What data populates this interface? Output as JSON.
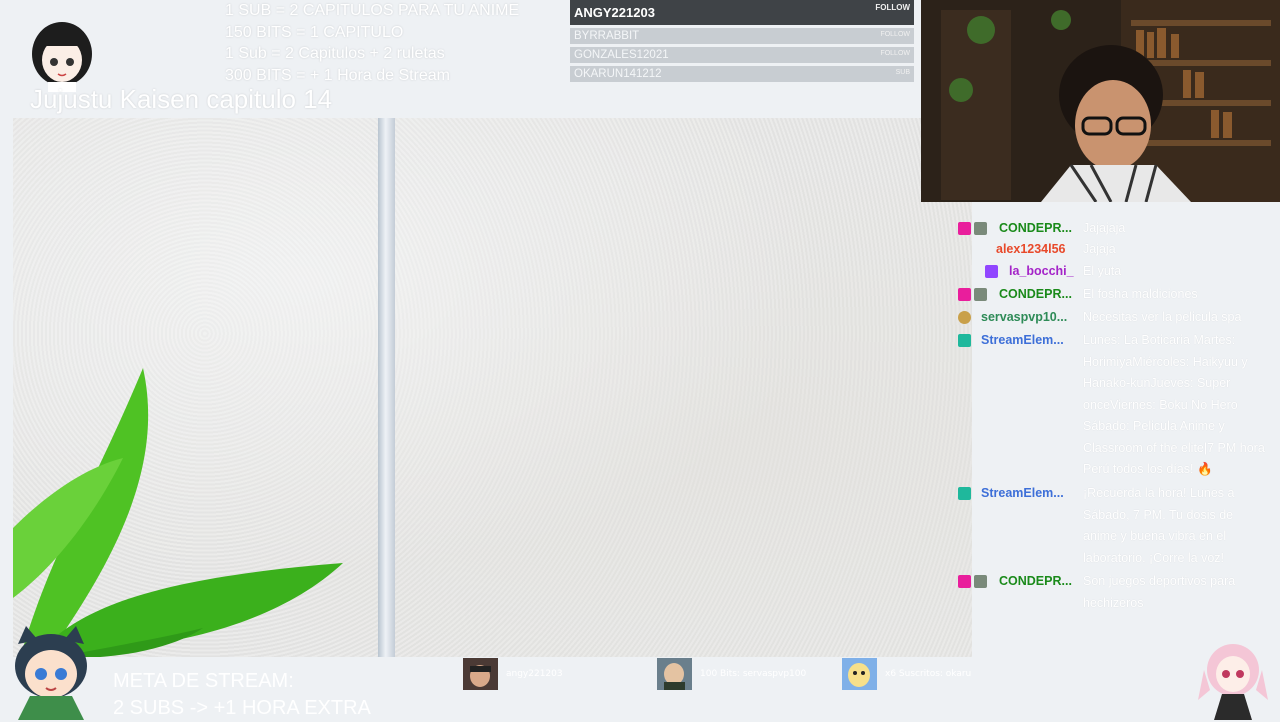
{
  "overlay": {
    "promo_lines": [
      "1 SUB = 2 CAPITULOS PARA TU ANIME",
      "150 BITS = 1 CAPITULO",
      "1 Sub = 2 Capitulos + 2 ruletas",
      "300 BITS = + 1 Hora de Stream"
    ],
    "episode_title": "Jujustu Kaisen capitulo 14"
  },
  "events": {
    "latest": {
      "name": "ANGY221203",
      "tag": "FOLLOW"
    },
    "rows": [
      {
        "name": "BYRRABBIT",
        "tag": "FOLLOW"
      },
      {
        "name": "GONZALES12021",
        "tag": "FOLLOW"
      },
      {
        "name": "OKARUN141212",
        "tag": "SUB"
      }
    ]
  },
  "chat": {
    "messages": [
      {
        "user": "CONDEPR...",
        "user_color": "#1a8a1a",
        "text": "Jajajaja",
        "badges": [
          "heart-badge",
          "gift-badge"
        ]
      },
      {
        "user": "alex1234l56",
        "user_color": "#e8492a",
        "text": "Jajaja",
        "badges": []
      },
      {
        "user": "la_bocchi_",
        "user_color": "#a424c8",
        "text": "El yuta",
        "badges": [
          "twitch-badge"
        ]
      },
      {
        "user": "CONDEPR...",
        "user_color": "#1a8a1a",
        "text": "El fosha maldiciones",
        "badges": [
          "heart-badge",
          "gift-badge"
        ]
      },
      {
        "user": "servaspvp10...",
        "user_color": "#2e8b57",
        "text": "Necesitas ver la pelicula spa",
        "badges": [
          "shield-badge"
        ]
      },
      {
        "user": "StreamElem...",
        "user_color": "#3d6fd8",
        "text": "Lunes: La Boticaria Martes: HorimiyaMiércoles: Haikyuu y Hanako-kunJueves: Super onceViernes: Boku No Hero Sábado: Pelicula Anime y Classroom of the elite|7 PM hora Perú todos los días! 🔥",
        "badges": [
          "bot-badge"
        ]
      },
      {
        "user": "StreamElem...",
        "user_color": "#3d6fd8",
        "text": "¡Recuerda la hora! Lunes a Sábado, 7 PM. Tu dosis de anime y buena vibra en el laboratorio. ¡Corre la voz!",
        "badges": [
          "bot-badge"
        ]
      },
      {
        "user": "CONDEPR...",
        "user_color": "#1a8a1a",
        "text": "Son juegos deportivos para hechizeros",
        "badges": [
          "heart-badge",
          "gift-badge"
        ]
      }
    ]
  },
  "bottom": {
    "goal_lines": [
      "META DE STREAM:",
      "2 SUBS  -> +1 HORA EXTRA"
    ],
    "supporters": [
      {
        "label": "angy221203"
      },
      {
        "label": "100 Bits: servaspvp100"
      },
      {
        "label": "x6 Suscritos: okaru"
      }
    ]
  },
  "colors": {
    "events_header_bg": "#3f4347",
    "heart_badge": "#e91e9c",
    "twitch_badge": "#9146ff",
    "bot_badge": "#1fb89c"
  }
}
